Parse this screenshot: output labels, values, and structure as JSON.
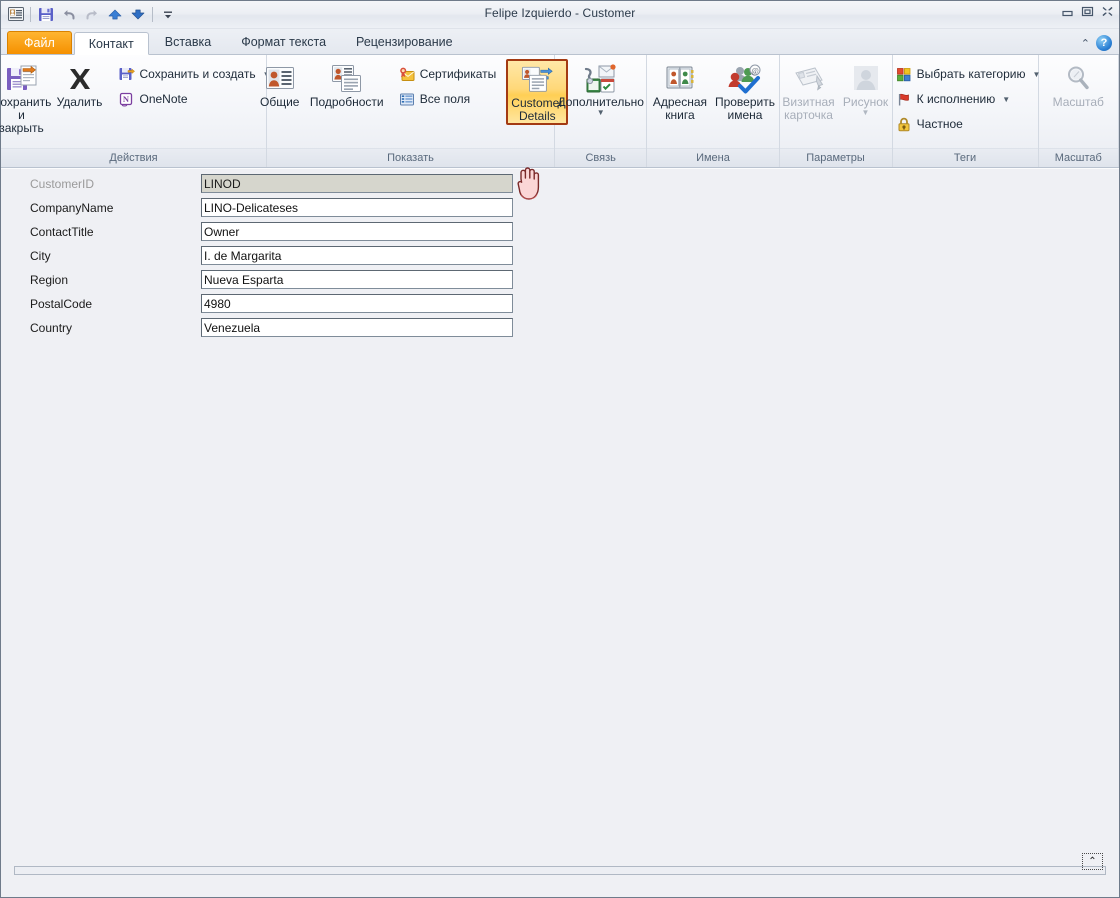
{
  "window": {
    "title": "Felipe Izquierdo  -  Customer",
    "controls": {
      "minimize": "—",
      "restore": "❐",
      "close": "✕"
    }
  },
  "quick_access": {
    "items": [
      {
        "name": "contact-card-icon",
        "tooltip": "Contact"
      },
      {
        "name": "save-icon",
        "tooltip": "Save"
      },
      {
        "name": "undo-icon",
        "tooltip": "Undo"
      },
      {
        "name": "redo-icon",
        "tooltip": "Redo"
      },
      {
        "name": "previous-item-icon",
        "tooltip": "Previous Item"
      },
      {
        "name": "next-item-icon",
        "tooltip": "Next Item"
      },
      {
        "name": "customize-qat-icon",
        "tooltip": "Customize Quick Access Toolbar"
      }
    ]
  },
  "tabs": {
    "file_label": "Файл",
    "items": [
      {
        "label": "Контакт",
        "active": true
      },
      {
        "label": "Вставка",
        "active": false
      },
      {
        "label": "Формат текста",
        "active": false
      },
      {
        "label": "Рецензирование",
        "active": false
      }
    ],
    "collapse_ribbon": "⌃",
    "help": "?"
  },
  "ribbon": {
    "groups": [
      {
        "name": "actions",
        "label": "Действия",
        "big_buttons": [
          {
            "label_line1": "Сохранить",
            "label_line2": "и закрыть",
            "icon": "save-close-icon",
            "disabled": false
          },
          {
            "label_line1": "Удалить",
            "label_line2": "",
            "icon": "delete-x-icon",
            "disabled": false
          }
        ],
        "small_buttons": [
          {
            "label": "Сохранить и создать",
            "icon": "save-new-icon",
            "caret": true
          },
          {
            "label": "OneNote",
            "icon": "onenote-icon",
            "caret": false
          }
        ]
      },
      {
        "name": "show",
        "label": "Показать",
        "big_buttons": [
          {
            "label_line1": "Общие",
            "label_line2": "",
            "icon": "general-person-icon",
            "disabled": false
          },
          {
            "label_line1": "Подробности",
            "label_line2": "",
            "icon": "details-icon",
            "disabled": false
          }
        ],
        "small_buttons": [
          {
            "label": "Сертификаты",
            "icon": "certificates-icon",
            "caret": false
          },
          {
            "label": "Все поля",
            "icon": "all-fields-icon",
            "caret": false
          }
        ],
        "selected_button": {
          "label_line1": "Customer",
          "label_line2": "Details",
          "icon": "customer-details-icon",
          "selected": true
        }
      },
      {
        "name": "communicate",
        "label": "Связь",
        "big_buttons": [
          {
            "label_line1": "Дополнительно",
            "label_line2": "",
            "icon": "more-communicate-icon",
            "caret": true,
            "disabled": false
          }
        ]
      },
      {
        "name": "names",
        "label": "Имена",
        "big_buttons": [
          {
            "label_line1": "Адресная",
            "label_line2": "книга",
            "icon": "address-book-icon",
            "disabled": false
          },
          {
            "label_line1": "Проверить",
            "label_line2": "имена",
            "icon": "check-names-icon",
            "disabled": false
          }
        ]
      },
      {
        "name": "options",
        "label": "Параметры",
        "big_buttons": [
          {
            "label_line1": "Визитная",
            "label_line2": "карточка",
            "icon": "business-card-icon",
            "disabled": true
          },
          {
            "label_line1": "Рисунок",
            "label_line2": "",
            "icon": "picture-icon",
            "caret": true,
            "disabled": true
          }
        ]
      },
      {
        "name": "tags",
        "label": "Теги",
        "small_buttons": [
          {
            "label": "Выбрать категорию",
            "icon": "categorize-icon",
            "caret": true
          },
          {
            "label": "К исполнению",
            "icon": "follow-up-flag-icon",
            "caret": true
          },
          {
            "label": "Частное",
            "icon": "private-lock-icon",
            "caret": false
          }
        ]
      },
      {
        "name": "zoom",
        "label": "Масштаб",
        "big_buttons": [
          {
            "label_line1": "Масштаб",
            "label_line2": "",
            "icon": "zoom-magnifier-icon",
            "disabled": true
          }
        ]
      }
    ]
  },
  "form": {
    "fields": [
      {
        "label": "CustomerID",
        "value": "LINOD",
        "readonly": true,
        "label_dim": true
      },
      {
        "label": "CompanyName",
        "value": "LINO-Delicateses",
        "readonly": false,
        "label_dim": false
      },
      {
        "label": "ContactTitle",
        "value": "Owner",
        "readonly": false,
        "label_dim": false
      },
      {
        "label": "City",
        "value": "I. de Margarita",
        "readonly": false,
        "label_dim": false
      },
      {
        "label": "Region",
        "value": "Nueva Esparta",
        "readonly": false,
        "label_dim": false
      },
      {
        "label": "PostalCode",
        "value": "4980",
        "readonly": false,
        "label_dim": false
      },
      {
        "label": "Country",
        "value": "Venezuela",
        "readonly": false,
        "label_dim": false
      }
    ]
  },
  "footer": {
    "scroll_up_label": "⌃"
  },
  "colors": {
    "accent_orange": "#f59000",
    "selected_button_border": "#a33a12",
    "selected_button_fill": "#ffd879",
    "window_bg": "#eff0f4",
    "ribbon_bg": "#f2f4f8",
    "readonly_field_bg": "#d6d6cd"
  }
}
